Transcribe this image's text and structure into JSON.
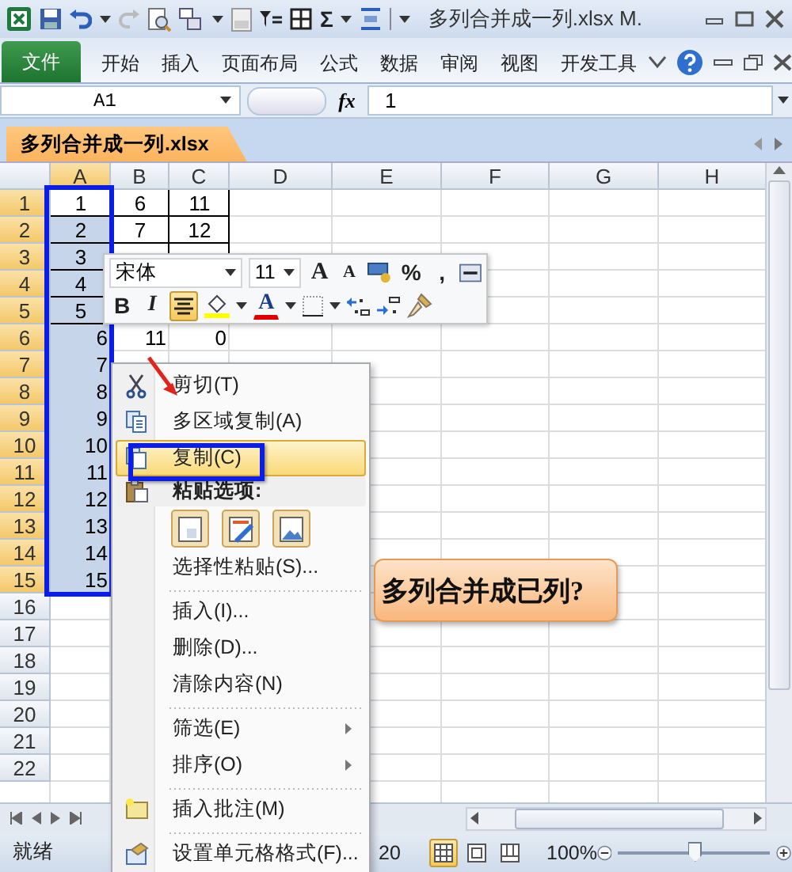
{
  "window": {
    "title": "多列合并成一列.xlsx M.",
    "sum_symbol": "Σ"
  },
  "ribbon": {
    "tabs": [
      {
        "label": "文件",
        "kind": "file",
        "selected": false
      },
      {
        "label": "开始",
        "kind": "tab",
        "selected": false
      },
      {
        "label": "插入",
        "kind": "tab",
        "selected": false
      },
      {
        "label": "页面布局",
        "kind": "tab",
        "selected": false
      },
      {
        "label": "公式",
        "kind": "tab",
        "selected": false
      },
      {
        "label": "数据",
        "kind": "tab",
        "selected": false
      },
      {
        "label": "审阅",
        "kind": "tab",
        "selected": false
      },
      {
        "label": "视图",
        "kind": "tab",
        "selected": false
      },
      {
        "label": "开发工具",
        "kind": "tab",
        "selected": false
      }
    ]
  },
  "formula_bar": {
    "name_box": "A1",
    "fx": "fx",
    "value": "1"
  },
  "workbook_tab": {
    "label": "多列合并成一列.xlsx"
  },
  "grid": {
    "columns": [
      {
        "label": "A",
        "selected": true
      },
      {
        "label": "B",
        "selected": false
      },
      {
        "label": "C",
        "selected": false
      },
      {
        "label": "D",
        "selected": false
      },
      {
        "label": "E",
        "selected": false
      },
      {
        "label": "F",
        "selected": false
      },
      {
        "label": "G",
        "selected": false
      },
      {
        "label": "H",
        "selected": false
      }
    ],
    "rows": [
      {
        "header": "1",
        "selected": true,
        "active": true,
        "bordered": true,
        "cells": [
          "1",
          "6",
          "11"
        ]
      },
      {
        "header": "2",
        "selected": true,
        "active": false,
        "bordered": true,
        "cells": [
          "2",
          "7",
          "12"
        ]
      },
      {
        "header": "3",
        "selected": true,
        "active": false,
        "bordered": true,
        "cells": [
          "3"
        ]
      },
      {
        "header": "4",
        "selected": true,
        "active": false,
        "bordered": true,
        "cells": [
          "4"
        ]
      },
      {
        "header": "5",
        "selected": true,
        "active": false,
        "bordered": true,
        "cells": [
          "5"
        ]
      },
      {
        "header": "6",
        "selected": true,
        "active": false,
        "bordered": false,
        "cells": [
          "6",
          "11",
          "0"
        ]
      },
      {
        "header": "7",
        "selected": true,
        "active": false,
        "bordered": false,
        "cells": [
          "7"
        ]
      },
      {
        "header": "8",
        "selected": true,
        "active": false,
        "bordered": false,
        "cells": [
          "8"
        ]
      },
      {
        "header": "9",
        "selected": true,
        "active": false,
        "bordered": false,
        "cells": [
          "9"
        ]
      },
      {
        "header": "10",
        "selected": true,
        "active": false,
        "bordered": false,
        "cells": [
          "10"
        ]
      },
      {
        "header": "11",
        "selected": true,
        "active": false,
        "bordered": false,
        "cells": [
          "11"
        ]
      },
      {
        "header": "12",
        "selected": true,
        "active": false,
        "bordered": false,
        "cells": [
          "12"
        ]
      },
      {
        "header": "13",
        "selected": true,
        "active": false,
        "bordered": false,
        "cells": [
          "13"
        ]
      },
      {
        "header": "14",
        "selected": true,
        "active": false,
        "bordered": false,
        "cells": [
          "14"
        ]
      },
      {
        "header": "15",
        "selected": true,
        "active": false,
        "bordered": false,
        "cells": [
          "15"
        ]
      },
      {
        "header": "16",
        "selected": false,
        "active": false,
        "bordered": false,
        "cells": []
      },
      {
        "header": "17",
        "selected": false,
        "active": false,
        "bordered": false,
        "cells": []
      },
      {
        "header": "18",
        "selected": false,
        "active": false,
        "bordered": false,
        "cells": []
      },
      {
        "header": "19",
        "selected": false,
        "active": false,
        "bordered": false,
        "cells": []
      },
      {
        "header": "20",
        "selected": false,
        "active": false,
        "bordered": false,
        "cells": []
      },
      {
        "header": "21",
        "selected": false,
        "active": false,
        "bordered": false,
        "cells": []
      },
      {
        "header": "22",
        "selected": false,
        "active": false,
        "bordered": false,
        "cells": []
      }
    ]
  },
  "mini_toolbar": {
    "font": "宋体",
    "size": "11",
    "grow_font": "A",
    "shrink_font": "A",
    "percent": "%",
    "comma": ",",
    "bold": "B",
    "italic": "I",
    "font_color": "A",
    "center_selected": true
  },
  "context_menu": {
    "items": [
      {
        "kind": "item",
        "label": "剪切(T)",
        "selected": false,
        "submenu": false,
        "separator_before": false
      },
      {
        "kind": "item",
        "label": "多区域复制(A)",
        "selected": false,
        "submenu": false,
        "separator_before": false
      },
      {
        "kind": "item",
        "label": "复制(C)",
        "selected": true,
        "submenu": false,
        "separator_before": false
      },
      {
        "kind": "header",
        "label": "粘贴选项:"
      },
      {
        "kind": "paste-icons"
      },
      {
        "kind": "item",
        "label": "选择性粘贴(S)...",
        "selected": false,
        "submenu": false,
        "separator_before": false
      },
      {
        "kind": "item",
        "label": "插入(I)...",
        "selected": false,
        "submenu": false,
        "separator_before": true
      },
      {
        "kind": "item",
        "label": "删除(D)...",
        "selected": false,
        "submenu": false,
        "separator_before": false
      },
      {
        "kind": "item",
        "label": "清除内容(N)",
        "selected": false,
        "submenu": false,
        "separator_before": false
      },
      {
        "kind": "item",
        "label": "筛选(E)",
        "selected": false,
        "submenu": true,
        "separator_before": true
      },
      {
        "kind": "item",
        "label": "排序(O)",
        "selected": false,
        "submenu": true,
        "separator_before": false
      },
      {
        "kind": "item",
        "label": "插入批注(M)",
        "selected": false,
        "submenu": false,
        "separator_before": true
      },
      {
        "kind": "item",
        "label": "设置单元格格式(F)...",
        "selected": false,
        "submenu": false,
        "separator_before": true
      }
    ]
  },
  "callout": {
    "text": "多列合并成已列?"
  },
  "status_bar": {
    "mode": "就绪",
    "sum": "20",
    "zoom": "100%",
    "views": [
      {
        "selected": true
      },
      {
        "selected": false
      },
      {
        "selected": false
      }
    ],
    "zoom_slider": {
      "level": 0.5
    }
  }
}
